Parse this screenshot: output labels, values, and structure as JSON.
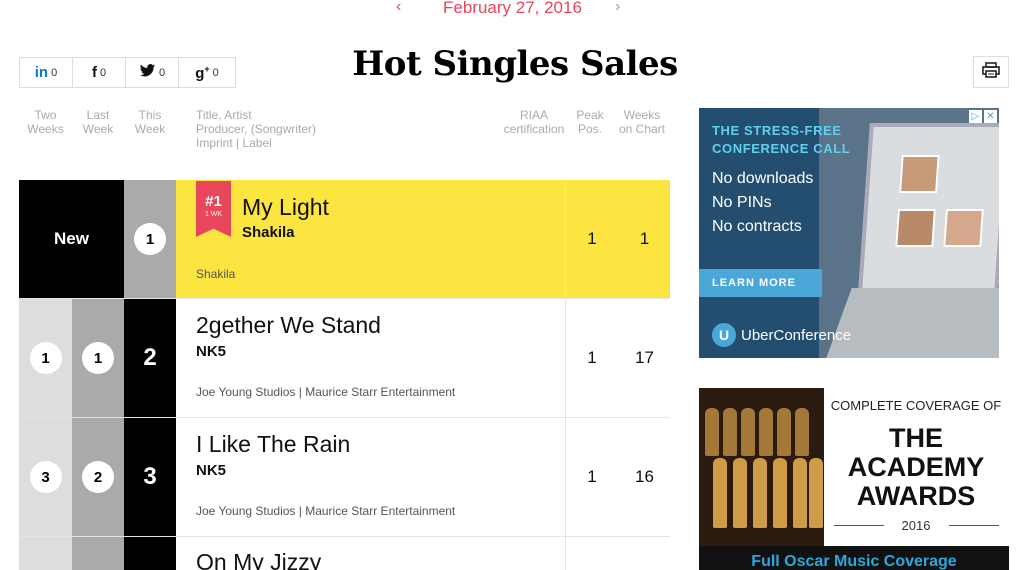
{
  "date_nav": {
    "prev_icon": "chevron-left-icon",
    "date": "February 27, 2016",
    "next_icon": "chevron-right-icon"
  },
  "share": [
    {
      "icon": "linkedin-icon",
      "glyph": "in",
      "count": "0"
    },
    {
      "icon": "facebook-icon",
      "glyph": "f",
      "count": "0"
    },
    {
      "icon": "twitter-icon",
      "glyph": "🐦",
      "count": "0"
    },
    {
      "icon": "google-plus-icon",
      "glyph": "g+",
      "count": "0"
    }
  ],
  "page_title": "Hot Singles Sales",
  "print_icon": "print-icon",
  "columns": {
    "two_weeks": "Two\nWeeks",
    "last_week": "Last\nWeek",
    "this_week": "This\nWeek",
    "title": "Title, Artist\nProducer, (Songwriter)\nImprint | Label",
    "riaa": "RIAA\ncertification",
    "peak": "Peak\nPos.",
    "weeks": "Weeks\non Chart"
  },
  "entries": [
    {
      "new_label": "New",
      "this_week": "1",
      "badge_rank": "#1",
      "badge_weeks": "1 WK",
      "title": "My Light",
      "artist": "Shakila",
      "label": "Shakila",
      "peak": "1",
      "weeks": "1"
    },
    {
      "two_weeks": "1",
      "last_week": "1",
      "this_week": "2",
      "title": "2gether We Stand",
      "artist": "NK5",
      "label": "Joe Young Studios | Maurice Starr Entertainment",
      "peak": "1",
      "weeks": "17"
    },
    {
      "two_weeks": "3",
      "last_week": "2",
      "this_week": "3",
      "title": "I Like The Rain",
      "artist": "NK5",
      "label": "Joe Young Studios | Maurice Starr Entertainment",
      "peak": "1",
      "weeks": "16"
    },
    {
      "title": "On My Jizzy"
    }
  ],
  "ad1": {
    "headline_1": "THE STRESS-FREE",
    "headline_2": "CONFERENCE CALL",
    "bullets": [
      "No downloads",
      "No PINs",
      "No contracts"
    ],
    "cta": "LEARN MORE",
    "brand": "UberConference",
    "brand_logo": "U"
  },
  "ad2": {
    "complete": "COMPLETE COVERAGE OF",
    "line1": "THE",
    "line2": "ACADEMY",
    "line3": "AWARDS",
    "year": "2016",
    "footer": "Full Oscar Music Coverage"
  }
}
